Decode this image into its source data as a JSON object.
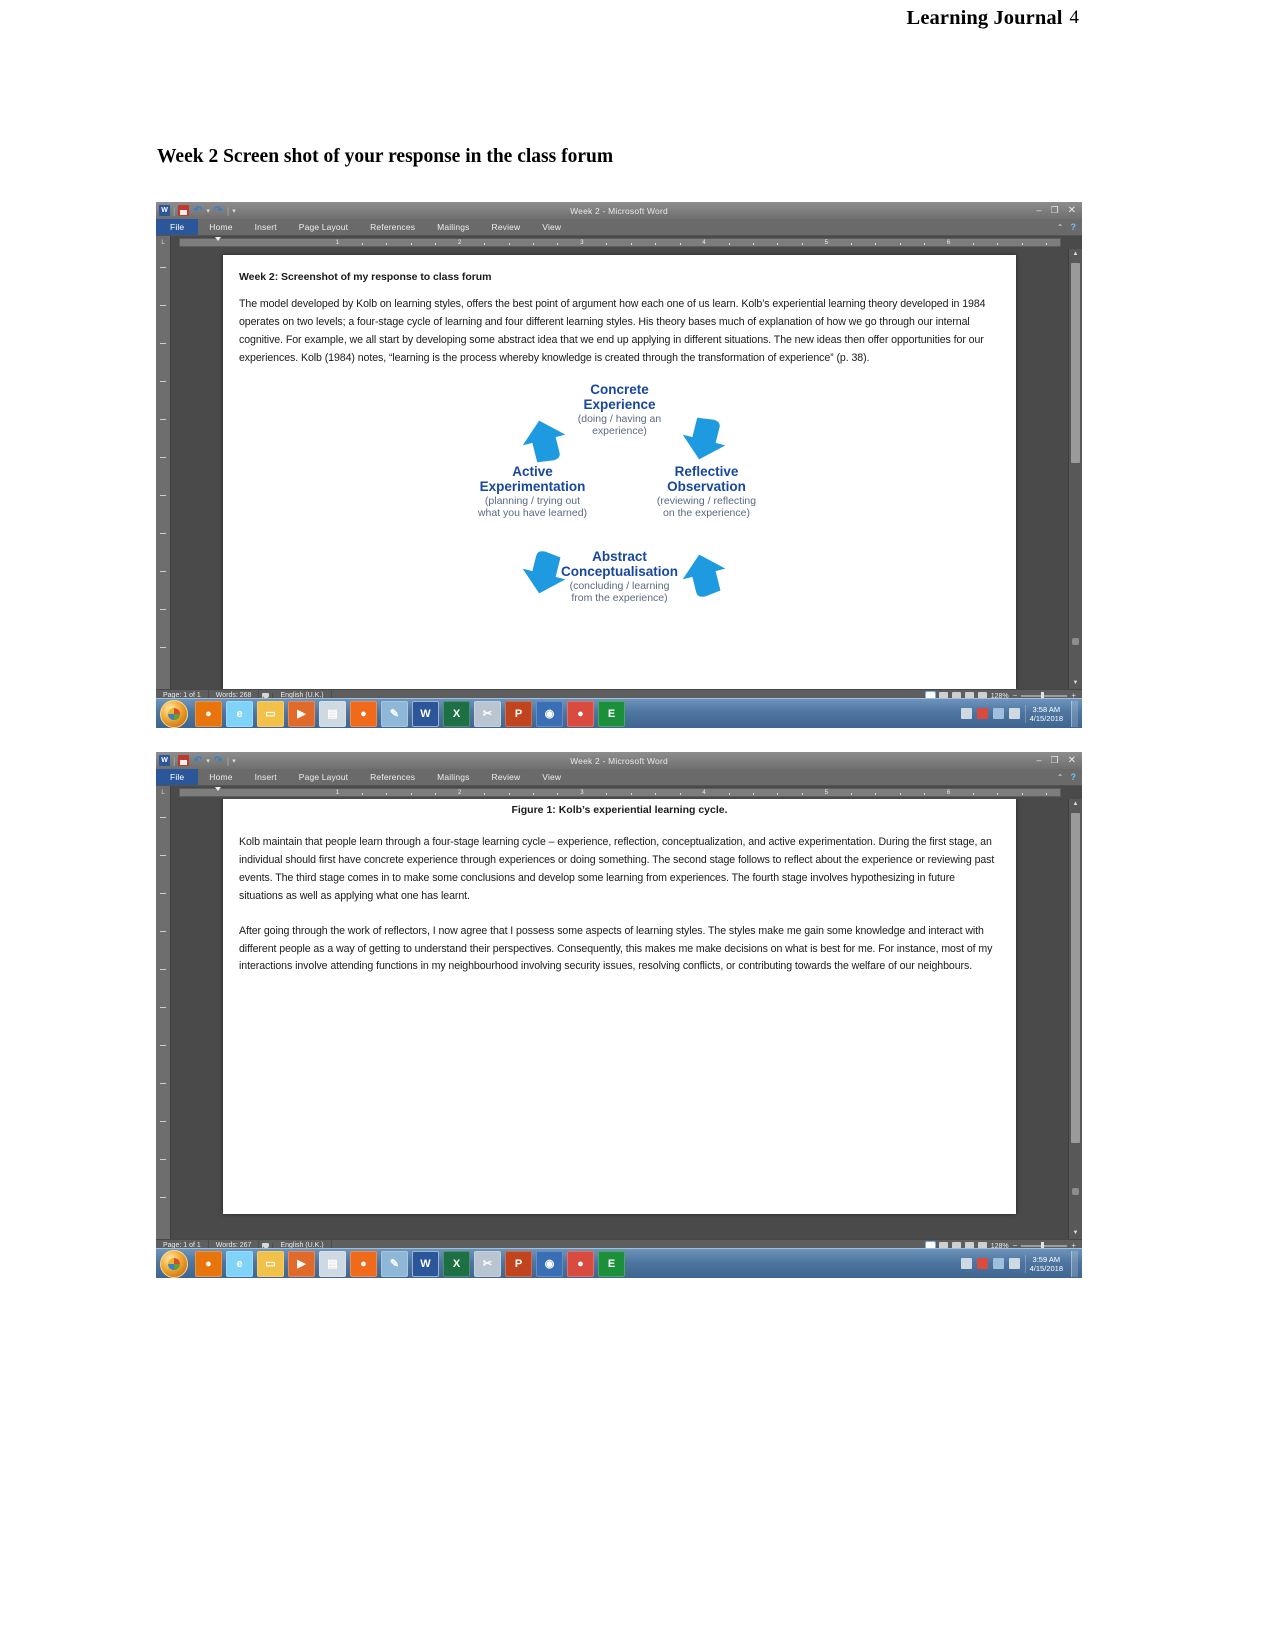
{
  "header": {
    "title": "Learning Journal",
    "page_number": "4"
  },
  "section_heading": "Week 2 Screen shot of your response in the class forum",
  "window1": {
    "titlebar": {
      "title": "Week 2  -  Microsoft Word",
      "qat": [
        "word-icon",
        "save-icon",
        "undo-icon",
        "redo-icon",
        "customize-qat-icon"
      ],
      "minimize": "–",
      "restore": "❐",
      "close": "✕"
    },
    "ribbon_tabs": [
      "File",
      "Home",
      "Insert",
      "Page Layout",
      "References",
      "Mailings",
      "Review",
      "View"
    ],
    "ribbon_right": {
      "collapse": "⌃",
      "help": "?"
    },
    "ruler_marks": [
      "1",
      "2",
      "3",
      "4",
      "5",
      "6"
    ],
    "document": {
      "heading": "Week 2: Screenshot of my response to class forum",
      "paragraph": "The model developed by Kolb on learning styles, offers the best point of argument how each one of us learn. Kolb’s experiential learning theory developed in 1984 operates on two levels; a four-stage cycle of learning and four different learning styles.  His theory bases much of explanation of how we go through our internal cognitive. For example, we all start by developing some abstract idea that we end up applying in different situations. The new ideas then offer opportunities for our experiences.  Kolb (1984) notes, “learning is the process whereby knowledge is created through the transformation of experience” (p. 38).",
      "kolb_diagram": {
        "nodes": [
          {
            "title": "Concrete\nExperience",
            "subtitle": "(doing / having an\nexperience)"
          },
          {
            "title": "Reflective\nObservation",
            "subtitle": "(reviewing / reflecting\non the experience)"
          },
          {
            "title": "Abstract\nConceptualisation",
            "subtitle": "(concluding / learning\nfrom the experience)"
          },
          {
            "title": "Active\nExperimentation",
            "subtitle": "(planning / trying out\nwhat you have learned)"
          }
        ],
        "title_color": "#17479e",
        "subtitle_color": "#5a6a80",
        "arrow_color": "#1e9ae0"
      }
    },
    "statusbar": {
      "page": "Page: 1 of 1",
      "words": "Words: 268",
      "language": "English (U.K.)",
      "zoom": "128%"
    }
  },
  "window2": {
    "titlebar": {
      "title": "Week 2  -  Microsoft Word",
      "minimize": "–",
      "restore": "❐",
      "close": "✕"
    },
    "ribbon_tabs": [
      "File",
      "Home",
      "Insert",
      "Page Layout",
      "References",
      "Mailings",
      "Review",
      "View"
    ],
    "ribbon_right": {
      "collapse": "⌃",
      "help": "?"
    },
    "ruler_marks": [
      "1",
      "2",
      "3",
      "4",
      "5",
      "6"
    ],
    "document": {
      "figure_caption": "Figure 1: Kolb’s experiential learning cycle.",
      "paragraph1": "Kolb maintain that people learn through a four-stage learning cycle – experience, reflection, conceptualization, and active experimentation. During the first stage, an individual should first have concrete experience through experiences or doing something. The second stage follows to reflect about the experience or reviewing past events. The third stage comes in to make some conclusions and develop some learning from experiences. The fourth stage involves hypothesizing in future situations as well as applying what one has learnt.",
      "paragraph2": "After going through the work of reflectors, I now agree that I possess some aspects of learning styles. The styles make me gain some knowledge and interact with different people as a way of getting to understand their perspectives. Consequently, this makes me make decisions on what is best for me. For instance, most of my interactions involve attending functions in my neighbourhood involving security issues, resolving conflicts, or contributing towards the welfare of our neighbours."
    },
    "statusbar": {
      "page": "Page: 1 of 1",
      "words": "Words: 267",
      "language": "English (U.K.)",
      "zoom": "128%"
    }
  },
  "taskbar1": {
    "clock_time": "3:58 AM",
    "clock_date": "4/15/2018",
    "items": [
      {
        "name": "firefox-taskbar-icon",
        "glyph": "●",
        "color": "#e8740c"
      },
      {
        "name": "internet-explorer-taskbar-icon",
        "glyph": "e",
        "color": "#7fd3f7"
      },
      {
        "name": "file-explorer-taskbar-icon",
        "glyph": "▭",
        "color": "#f2c14a"
      },
      {
        "name": "media-player-taskbar-icon",
        "glyph": "▶",
        "color": "#e06a2a"
      },
      {
        "name": "calculator-taskbar-icon",
        "glyph": "▤",
        "color": "#cfd9e2"
      },
      {
        "name": "mozilla-taskbar-icon",
        "glyph": "●",
        "color": "#f06a1c"
      },
      {
        "name": "paint-taskbar-icon",
        "glyph": "✎",
        "color": "#8fb8d8"
      },
      {
        "name": "word-taskbar-icon",
        "glyph": "W",
        "color": "#2b579a"
      },
      {
        "name": "excel-taskbar-icon",
        "glyph": "X",
        "color": "#1d7044"
      },
      {
        "name": "snipping-tool-taskbar-icon",
        "glyph": "✂",
        "color": "#b9c6d2"
      },
      {
        "name": "powerpoint-taskbar-icon",
        "glyph": "P",
        "color": "#c0451f"
      },
      {
        "name": "zotero-taskbar-icon",
        "glyph": "◉",
        "color": "#3a6fb5"
      },
      {
        "name": "chrome-taskbar-icon",
        "glyph": "●",
        "color": "#d94b3f"
      },
      {
        "name": "edge-taskbar-icon",
        "glyph": "E",
        "color": "#1b8f3a"
      }
    ]
  },
  "taskbar2": {
    "clock_time": "3:59 AM",
    "clock_date": "4/15/2018"
  }
}
